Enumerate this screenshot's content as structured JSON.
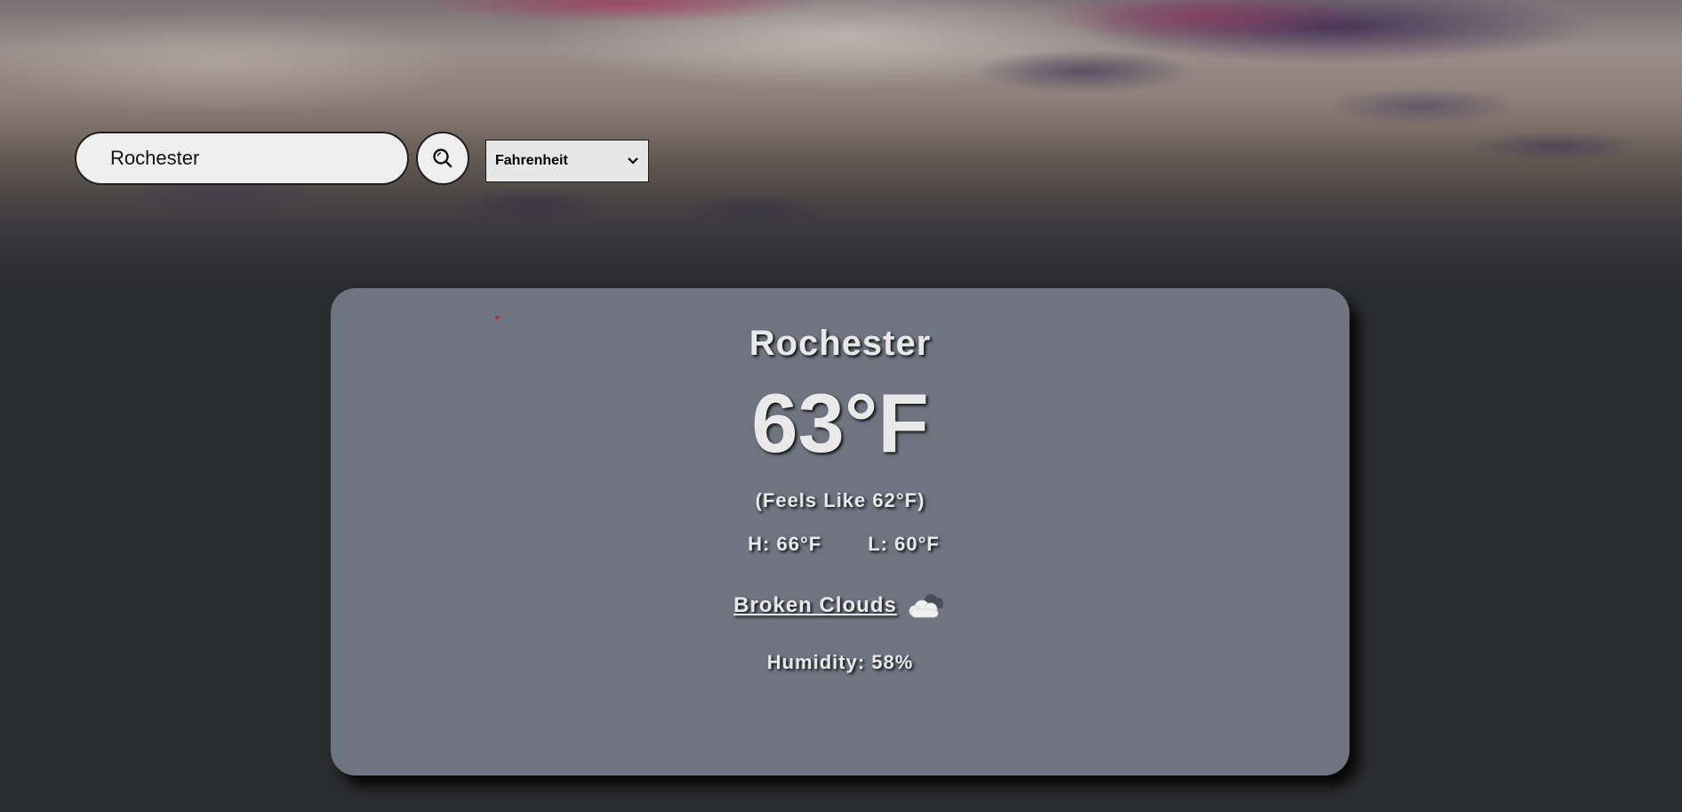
{
  "search": {
    "value": "Rochester",
    "icon": "search-icon"
  },
  "unit_select": {
    "selected": "Fahrenheit",
    "icon": "chevron-down-icon"
  },
  "weather": {
    "city": "Rochester",
    "temperature": "63°F",
    "feels_like": "(Feels Like 62°F)",
    "high": "H: 66°F",
    "low": "L: 60°F",
    "condition": "Broken Clouds",
    "condition_icon": "broken-clouds-icon",
    "humidity": "Humidity: 58%"
  },
  "colors": {
    "page_background": "#2b2c2e",
    "card_background": "#6e7580",
    "text": "#e9e9e9",
    "dot": "#d0202a"
  }
}
